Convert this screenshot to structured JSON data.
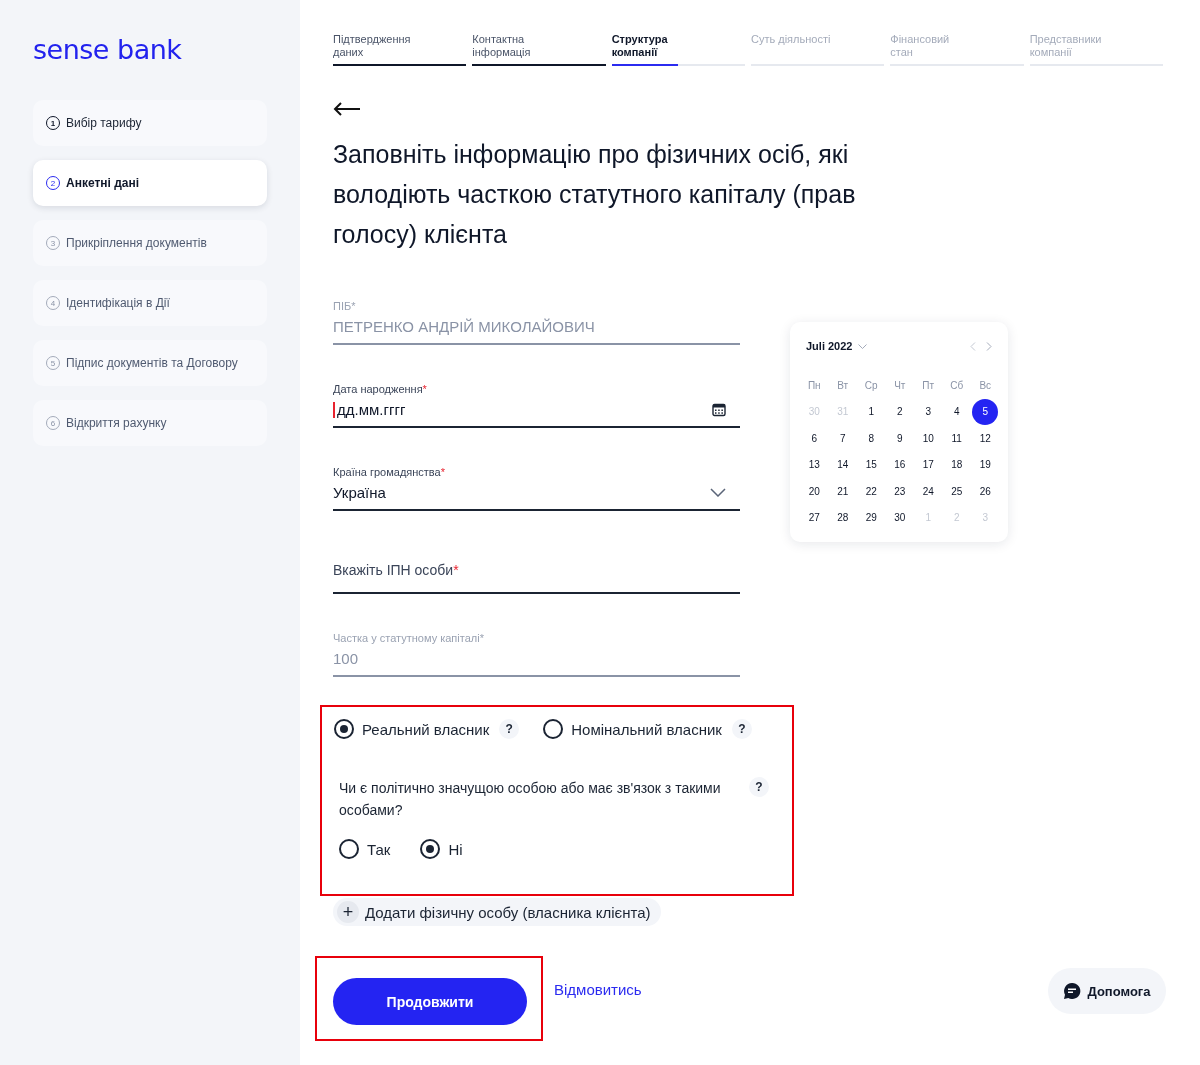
{
  "brand": {
    "logo": "sense bank"
  },
  "steps": [
    {
      "number": "1",
      "label": "Вибір тарифу",
      "kind": "done"
    },
    {
      "number": "2",
      "label": "Анкетні дані",
      "kind": "current"
    },
    {
      "number": "3",
      "label": "Прикріплення документів",
      "kind": "upcoming"
    },
    {
      "number": "4",
      "label": "Ідентифікація в Дії",
      "kind": "upcoming"
    },
    {
      "number": "5",
      "label": "Підпис документів та Договору",
      "kind": "upcoming"
    },
    {
      "number": "6",
      "label": "Відкриття рахунку",
      "kind": "upcoming"
    }
  ],
  "tabs": [
    {
      "label": "Підтвердження даних",
      "kind": "done",
      "selected": false,
      "level": 1
    },
    {
      "label": "Контактна інформація",
      "kind": "done",
      "selected": false,
      "level": 1
    },
    {
      "label": "Структура компанії",
      "kind": "current",
      "selected": true,
      "level": 0.5
    },
    {
      "label": "Суть діяльності",
      "kind": "upcoming",
      "selected": false,
      "level": 0
    },
    {
      "label": "Фінансовий стан",
      "kind": "upcoming",
      "selected": false,
      "level": 0
    },
    {
      "label": "Представники компанії",
      "kind": "upcoming",
      "selected": false,
      "level": 0
    }
  ],
  "title": "Заповніть інформацію про фізичних осіб, які володіють часткою статутного капіталу (прав голосу) клієнта",
  "fields": [
    {
      "kind": "text",
      "label": "ПІБ",
      "mark": "*",
      "value": "ПЕТРЕНКО АНДРІЙ МИКОЛАЙОВИЧ",
      "disabled": true
    },
    {
      "kind": "date",
      "label": "Дата народження",
      "mark": "*",
      "value": "дд.мм.гггг",
      "disabled": false,
      "focused": true
    },
    {
      "kind": "select",
      "label": "Країна громадянства",
      "mark": "*",
      "value": "Україна",
      "disabled": false
    },
    {
      "kind": "text",
      "label": "Вкажіть ІПН особи",
      "mark": "*",
      "disabled": false
    },
    {
      "kind": "text",
      "label": "Частка у статутному капіталі",
      "mark": "*",
      "value": "100",
      "disabled": true
    }
  ],
  "calendar": {
    "month": "Juli 2022",
    "weekdays": [
      "Пн",
      "Вт",
      "Ср",
      "Чт",
      "Пт",
      "Сб",
      "Вс"
    ],
    "days": [
      {
        "label": "30",
        "muted": true,
        "selected": false
      },
      {
        "label": "31",
        "muted": true,
        "selected": false
      },
      {
        "label": "1",
        "muted": false,
        "selected": false
      },
      {
        "label": "2",
        "muted": false,
        "selected": false
      },
      {
        "label": "3",
        "muted": false,
        "selected": false
      },
      {
        "label": "4",
        "muted": false,
        "selected": false
      },
      {
        "label": "5",
        "muted": false,
        "selected": true
      },
      {
        "label": "6",
        "muted": false,
        "selected": false
      },
      {
        "label": "7",
        "muted": false,
        "selected": false
      },
      {
        "label": "8",
        "muted": false,
        "selected": false
      },
      {
        "label": "9",
        "muted": false,
        "selected": false
      },
      {
        "label": "10",
        "muted": false,
        "selected": false
      },
      {
        "label": "11",
        "muted": false,
        "selected": false
      },
      {
        "label": "12",
        "muted": false,
        "selected": false
      },
      {
        "label": "13",
        "muted": false,
        "selected": false
      },
      {
        "label": "14",
        "muted": false,
        "selected": false
      },
      {
        "label": "15",
        "muted": false,
        "selected": false
      },
      {
        "label": "16",
        "muted": false,
        "selected": false
      },
      {
        "label": "17",
        "muted": false,
        "selected": false
      },
      {
        "label": "18",
        "muted": false,
        "selected": false
      },
      {
        "label": "19",
        "muted": false,
        "selected": false
      },
      {
        "label": "20",
        "muted": false,
        "selected": false
      },
      {
        "label": "21",
        "muted": false,
        "selected": false
      },
      {
        "label": "22",
        "muted": false,
        "selected": false
      },
      {
        "label": "23",
        "muted": false,
        "selected": false
      },
      {
        "label": "24",
        "muted": false,
        "selected": false
      },
      {
        "label": "25",
        "muted": false,
        "selected": false
      },
      {
        "label": "26",
        "muted": false,
        "selected": false
      },
      {
        "label": "27",
        "muted": false,
        "selected": false
      },
      {
        "label": "28",
        "muted": false,
        "selected": false
      },
      {
        "label": "29",
        "muted": false,
        "selected": false
      },
      {
        "label": "30",
        "muted": false,
        "selected": false
      },
      {
        "label": "1",
        "muted": true,
        "selected": false
      },
      {
        "label": "2",
        "muted": true,
        "selected": false
      },
      {
        "label": "3",
        "muted": true,
        "selected": false
      }
    ]
  },
  "owner_type": {
    "highlighted": true,
    "options": [
      {
        "label": "Реальний власник",
        "selected": true,
        "help": "?"
      },
      {
        "label": "Номінальний власник",
        "selected": false,
        "help": "?"
      }
    ],
    "question": "Чи є політично значущою особою або має зв'язок з такими особами?",
    "question_help": "?",
    "answers": [
      {
        "label": "Так",
        "selected": false
      },
      {
        "label": "Ні",
        "selected": true
      }
    ]
  },
  "add_person": {
    "icon": "+",
    "label": "Додати фізичну особу (власника клієнта)"
  },
  "actions": {
    "highlighted": true,
    "primary": "Продовжити",
    "secondary": "Відмовитись"
  },
  "help": {
    "label": "Допомога"
  }
}
